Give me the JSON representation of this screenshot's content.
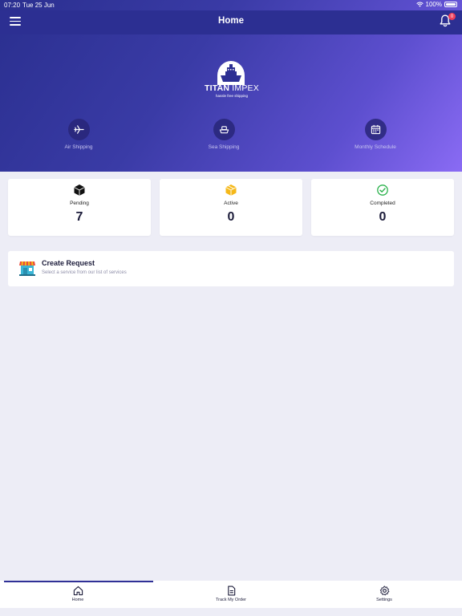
{
  "status": {
    "time": "07:20",
    "date": "Tue 25 Jun",
    "battery": "100%"
  },
  "appbar": {
    "title": "Home",
    "notification_count": "0"
  },
  "logo": {
    "brand_bold": "TITAN",
    "brand_light": "IMPEX",
    "tagline": "hassle free shipping"
  },
  "services": [
    {
      "label": "Air Shipping",
      "icon": "airplane-icon"
    },
    {
      "label": "Sea Shipping",
      "icon": "ship-icon"
    },
    {
      "label": "Monthly Schedule",
      "icon": "calendar-icon"
    }
  ],
  "stats": [
    {
      "label": "Pending",
      "value": "7",
      "icon": "box-icon",
      "color": "#111111"
    },
    {
      "label": "Active",
      "value": "0",
      "icon": "package-icon",
      "color": "#f5b819"
    },
    {
      "label": "Completed",
      "value": "0",
      "icon": "check-circle-icon",
      "color": "#2bb24c"
    }
  ],
  "create_request": {
    "title": "Create Request",
    "subtitle": "Select a service from our list of services"
  },
  "nav": [
    {
      "label": "Home",
      "icon": "home-icon"
    },
    {
      "label": "Track My Order",
      "icon": "document-icon"
    },
    {
      "label": "Settings",
      "icon": "gear-icon"
    }
  ],
  "colors": {
    "header": "#2c2f92",
    "accent": "#8a6bf4",
    "background": "#ededf6"
  }
}
